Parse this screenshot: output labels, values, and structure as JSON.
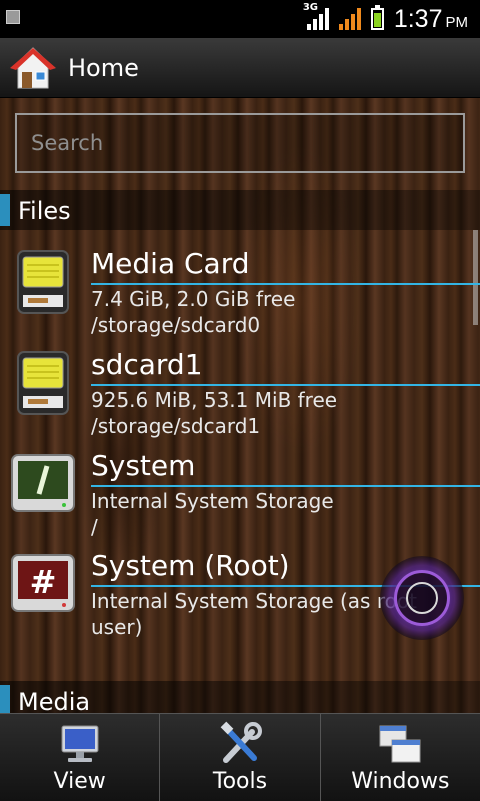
{
  "status_bar": {
    "time": "1:37",
    "ampm": "PM",
    "network_type": "3G"
  },
  "header": {
    "title": "Home"
  },
  "search": {
    "placeholder": "Search",
    "value": ""
  },
  "sections": [
    {
      "label": "Files"
    },
    {
      "label": "Media"
    }
  ],
  "files": [
    {
      "title": "Media Card",
      "detail": "7.4 GiB, 2.0 GiB free",
      "path": "/storage/sdcard0",
      "icon": "sd-card-icon"
    },
    {
      "title": "sdcard1",
      "detail": "925.6 MiB, 53.1 MiB free",
      "path": "/storage/sdcard1",
      "icon": "sd-card-icon"
    },
    {
      "title": "System",
      "detail": "Internal System Storage",
      "path": "/",
      "icon": "system-terminal-icon"
    },
    {
      "title": "System (Root)",
      "detail": "Internal System Storage (as root",
      "path": "user)",
      "icon": "root-terminal-icon"
    }
  ],
  "bottom_tabs": [
    {
      "label": "View",
      "icon": "monitor-icon"
    },
    {
      "label": "Tools",
      "icon": "tools-icon"
    },
    {
      "label": "Windows",
      "icon": "windows-icon"
    }
  ],
  "colors": {
    "accent": "#33b5e5",
    "section_accent": "#2b8fbd",
    "fab_ring": "#9c5bd8"
  }
}
